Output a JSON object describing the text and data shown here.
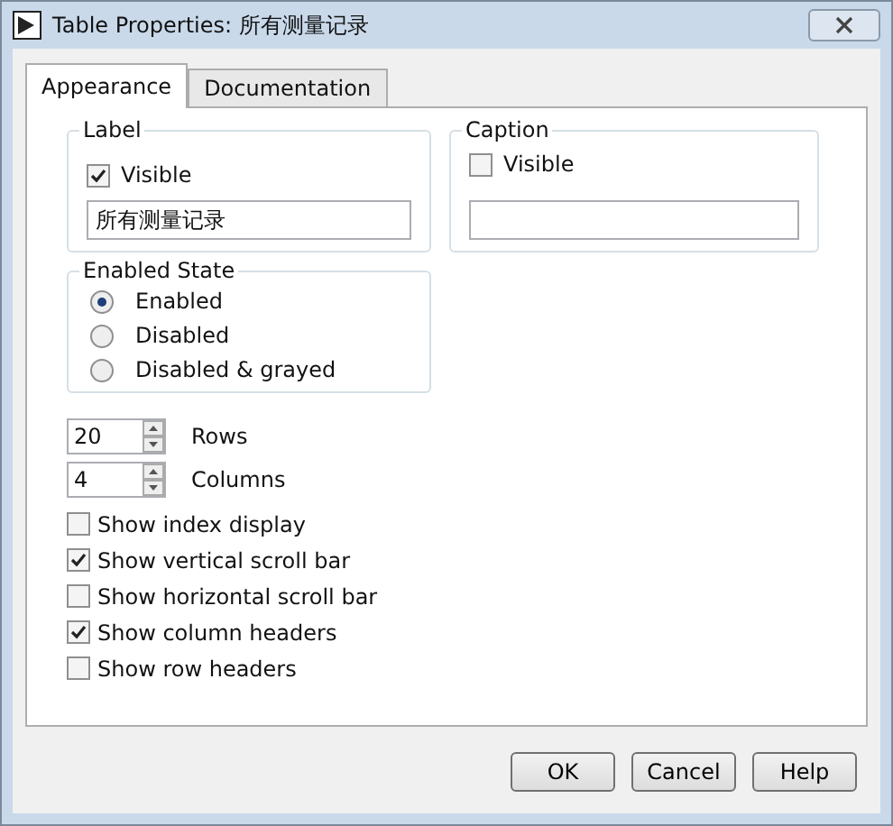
{
  "window": {
    "title": "Table Properties: 所有测量记录"
  },
  "tabs": [
    {
      "label": "Appearance",
      "selected": true
    },
    {
      "label": "Documentation",
      "selected": false
    }
  ],
  "label_group": {
    "title": "Label",
    "checkbox": {
      "label": "Visible",
      "checked": true
    },
    "value": "所有测量记录"
  },
  "caption_group": {
    "title": "Caption",
    "checkbox": {
      "label": "Visible",
      "checked": false
    }
  },
  "enabled_state": {
    "title": "Enabled State",
    "options": [
      {
        "label": "Enabled",
        "selected": true
      },
      {
        "label": "Disabled",
        "selected": false
      },
      {
        "label": "Disabled & grayed",
        "selected": false
      }
    ]
  },
  "spinners": [
    {
      "value": "20",
      "label": "Rows"
    },
    {
      "value": "4",
      "label": "Columns"
    }
  ],
  "options": [
    {
      "label": "Show index display",
      "checked": false
    },
    {
      "label": "Show vertical scroll bar",
      "checked": true
    },
    {
      "label": "Show horizontal scroll bar",
      "checked": false
    },
    {
      "label": "Show column headers",
      "checked": true
    },
    {
      "label": "Show row headers",
      "checked": false
    }
  ],
  "buttons": [
    "OK",
    "Cancel",
    "Help"
  ]
}
